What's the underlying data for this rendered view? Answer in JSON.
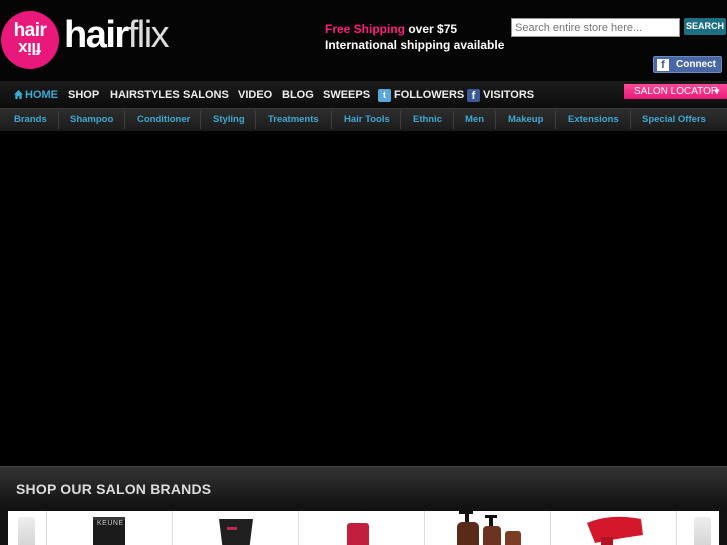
{
  "header": {
    "logo_top": "hair",
    "logo_bottom": "flix",
    "wordmark_bold": "hair",
    "wordmark_light": "flix",
    "promo_highlight": "Free Shipping",
    "promo_rest": " over $75",
    "promo_line2": "International shipping available",
    "search_placeholder": "Search entire store here...",
    "search_button": "SEARCH",
    "facebook_connect": "Connect",
    "facebook_glyph": "f"
  },
  "main_nav": [
    {
      "label": "HOME",
      "icon": "home-icon"
    },
    {
      "label": "SHOP"
    },
    {
      "label": "HAIRSTYLES"
    },
    {
      "label": "SALONS"
    },
    {
      "label": "VIDEO"
    },
    {
      "label": "BLOG"
    },
    {
      "label": "SWEEPS"
    },
    {
      "label": "FOLLOWERS",
      "icon": "twitter-icon"
    },
    {
      "label": "VISITORS",
      "icon": "facebook-icon"
    }
  ],
  "salon_locator": "SALON LOCATOR",
  "categories": [
    "Brands",
    "Shampoo",
    "Conditioner",
    "Styling",
    "Treatments",
    "Hair Tools",
    "Ethnic",
    "Men",
    "Makeup",
    "Extensions",
    "Special Offers"
  ],
  "brands_section": {
    "title": "SHOP OUR SALON BRANDS",
    "products": [
      {
        "name": "product-keune",
        "brand_text": "KEUNE"
      },
      {
        "name": "product-tube"
      },
      {
        "name": "product-red-bottle"
      },
      {
        "name": "product-pump-bottles"
      },
      {
        "name": "product-red-dryer"
      }
    ]
  },
  "colors": {
    "brand_pink": "#e8197a",
    "accent_blue": "#3fa9d2",
    "search_button": "#1d6f84",
    "facebook_blue": "#3b5998"
  }
}
